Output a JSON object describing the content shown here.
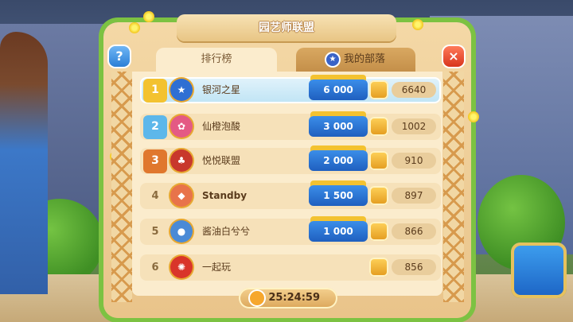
{
  "panel": {
    "title": "园艺师联盟",
    "help_label": "?",
    "close_label": "×",
    "tabs": [
      {
        "label": "排行榜",
        "active": true
      },
      {
        "label": "我的部落",
        "active": false
      }
    ]
  },
  "leaderboard": [
    {
      "rank": "1",
      "team": "银河之星",
      "reward": "6 000",
      "score": "6640",
      "badge_icon": "star-shield-icon",
      "highlight": true
    },
    {
      "rank": "2",
      "team": "仙橙泡酸",
      "reward": "3 000",
      "score": "1002",
      "badge_icon": "flower-shield-icon",
      "highlight": false
    },
    {
      "rank": "3",
      "team": "悦悦联盟",
      "reward": "2 000",
      "score": "910",
      "badge_icon": "acorn-shield-icon",
      "highlight": false
    },
    {
      "rank": "4",
      "team": "Standby",
      "reward": "1 500",
      "score": "897",
      "badge_icon": "diamond-shield-icon",
      "highlight": false
    },
    {
      "rank": "5",
      "team": "酱油白兮兮",
      "reward": "1 000",
      "score": "866",
      "badge_icon": "paw-shield-icon",
      "highlight": false
    },
    {
      "rank": "6",
      "team": "一起玩",
      "reward": "",
      "score": "856",
      "badge_icon": "sun-shield-icon",
      "highlight": false
    }
  ],
  "timer": {
    "value": "25:24:59"
  },
  "colors": {
    "gold": "#f3c230",
    "silver": "#5db7ea",
    "bronze": "#e0772d",
    "reward_blue": "#1f5fbf",
    "panel_bg": "#fbeccd"
  }
}
